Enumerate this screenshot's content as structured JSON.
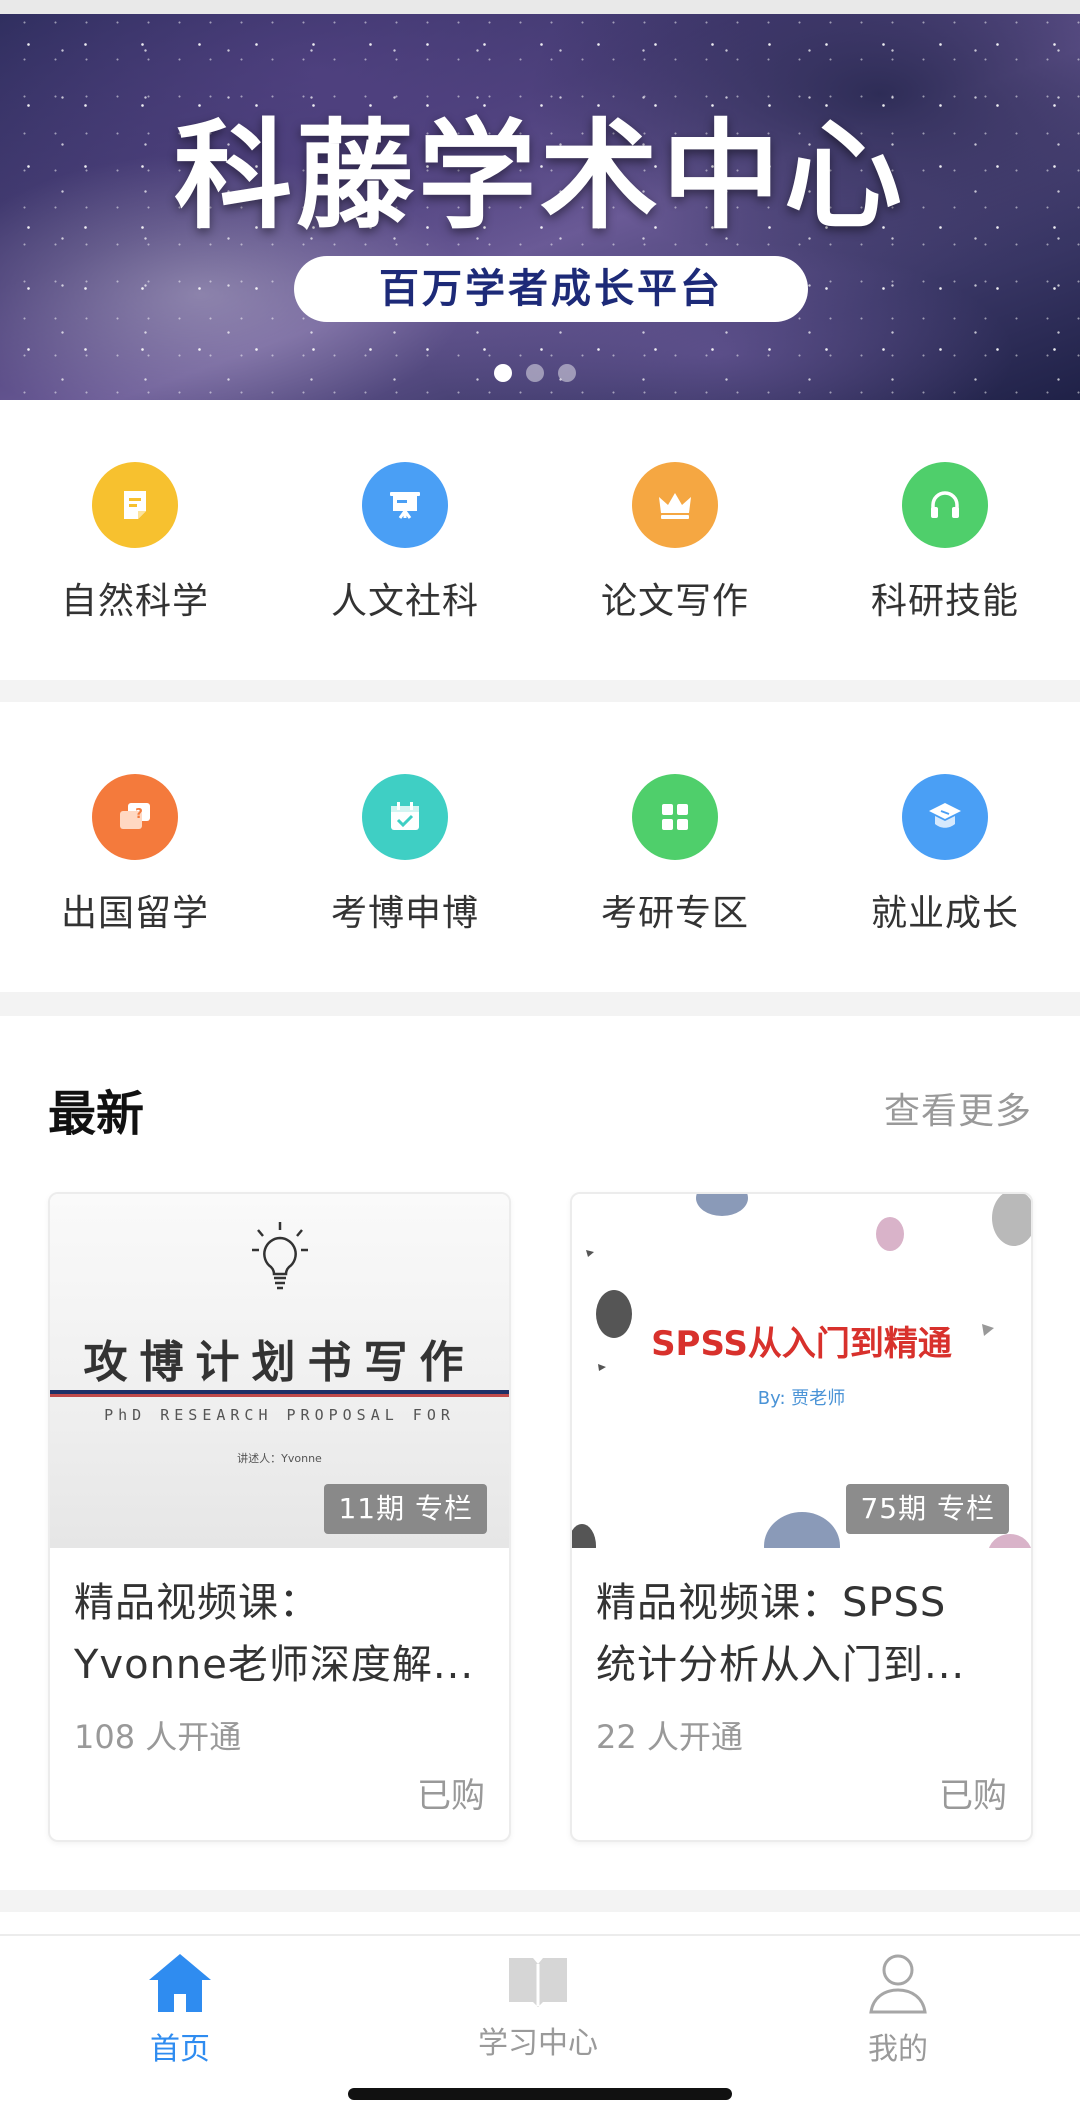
{
  "banner": {
    "title": "科藤学术中心",
    "subtitle": "百万学者成长平台",
    "slide_count": 3,
    "active_slide": 1
  },
  "categories_row1": [
    {
      "label": "自然科学",
      "icon": "note-icon",
      "color": "#f7c12f"
    },
    {
      "label": "人文社科",
      "icon": "presentation-board-icon",
      "color": "#4a9ff5"
    },
    {
      "label": "论文写作",
      "icon": "crown-icon",
      "color": "#f5a742"
    },
    {
      "label": "科研技能",
      "icon": "headphones-icon",
      "color": "#4fcf6b"
    }
  ],
  "categories_row2": [
    {
      "label": "出国留学",
      "icon": "question-chat-icon",
      "color": "#f47a3c"
    },
    {
      "label": "考博申博",
      "icon": "calendar-check-icon",
      "color": "#3fcfc4"
    },
    {
      "label": "考研专区",
      "icon": "grid-icon",
      "color": "#4fcf6b"
    },
    {
      "label": "就业成长",
      "icon": "graduation-cap-icon",
      "color": "#4a9ff5"
    }
  ],
  "latest": {
    "title": "最新",
    "more_label": "查看更多",
    "cards": [
      {
        "cover_title": "攻博计划书写作",
        "cover_subtitle": "PhD RESEARCH PROPOSAL FOR",
        "cover_author": "讲述人：Yvonne",
        "badge": "11期 专栏",
        "title_line1": "精品视频课：",
        "title_line2": "Yvonne老师深度解...",
        "subscribers": "108 人开通",
        "status": "已购"
      },
      {
        "cover_title": "SPSS从入门到精通",
        "cover_author": "By: 贾老师",
        "badge": "75期 专栏",
        "title_line1": "精品视频课：SPSS",
        "title_line2": "统计分析从入门到...",
        "subscribers": "22 人开通",
        "status": "已购"
      }
    ]
  },
  "tabbar": {
    "items": [
      {
        "label": "首页",
        "icon": "home-icon",
        "active": true
      },
      {
        "label": "学习中心",
        "icon": "book-icon",
        "active": false
      },
      {
        "label": "我的",
        "icon": "user-icon",
        "active": false
      }
    ],
    "active_color": "#2f8cf0",
    "inactive_color": "#9a9a9a"
  }
}
